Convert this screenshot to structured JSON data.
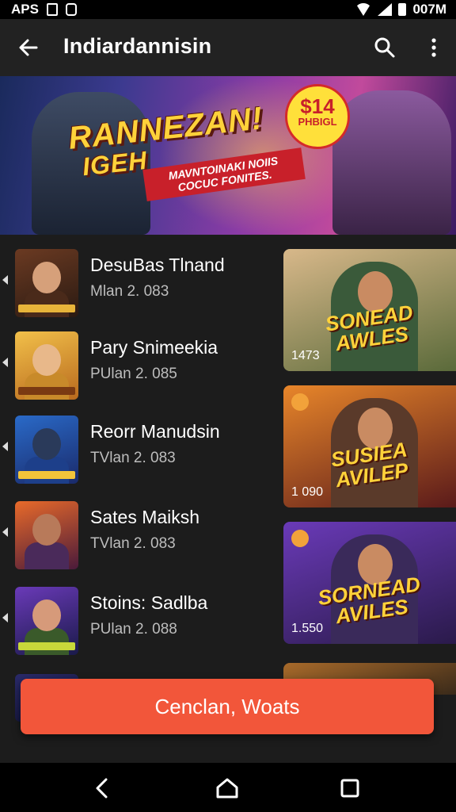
{
  "status_bar": {
    "left_text": "APS",
    "time": "007M"
  },
  "app_bar": {
    "title": "Indiardannisin"
  },
  "banner": {
    "headline": "RANNEZAN!",
    "headline2": "IGEH",
    "tag": "MAVNTOINAKI NOIIS COCUC FONITES.",
    "price": "$14",
    "price_sub": "PHBIGL"
  },
  "list": [
    {
      "name": "DesuBas Tlnand",
      "meta": "Mlan 2. 083"
    },
    {
      "name": "Pary Snimeekia",
      "meta": "PUlan 2. 085"
    },
    {
      "name": "Reorr Manudsin",
      "meta": "TVlan 2. 083"
    },
    {
      "name": "Sates Maiksh",
      "meta": "TVlan 2. 083"
    },
    {
      "name": "Stoins: Sadlba",
      "meta": "PUlan 2. 088"
    }
  ],
  "cards": [
    {
      "title": "SONEAD AWLES",
      "count": "1473"
    },
    {
      "title": "SUSIEA AVILEP",
      "count": "1 090"
    },
    {
      "title": "SORNEAD AVILES",
      "count": "1.550"
    }
  ],
  "cta": {
    "label": "Cenclan, Woats"
  },
  "colors": {
    "accent": "#f2563a",
    "progress": "#e8c233",
    "background": "#1c1c1c"
  }
}
